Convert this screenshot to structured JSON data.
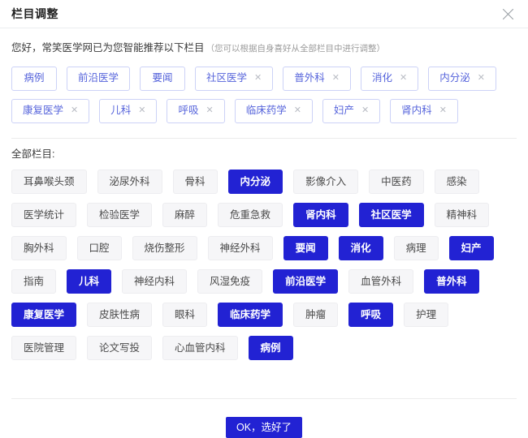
{
  "dialog": {
    "title": "栏目调整",
    "close_icon": "close-icon"
  },
  "intro": {
    "text": "您好，常笑医学网已为您智能推荐以下栏目",
    "hint": "（您可以根据自身喜好从全部栏目中进行调整）"
  },
  "selected_chips": [
    {
      "label": "病例",
      "removable": false
    },
    {
      "label": "前沿医学",
      "removable": false
    },
    {
      "label": "要闻",
      "removable": false
    },
    {
      "label": "社区医学",
      "removable": true
    },
    {
      "label": "普外科",
      "removable": true
    },
    {
      "label": "消化",
      "removable": true
    },
    {
      "label": "内分泌",
      "removable": true
    },
    {
      "label": "康复医学",
      "removable": true
    },
    {
      "label": "儿科",
      "removable": true
    },
    {
      "label": "呼吸",
      "removable": true
    },
    {
      "label": "临床药学",
      "removable": true
    },
    {
      "label": "妇产",
      "removable": true
    },
    {
      "label": "肾内科",
      "removable": true
    }
  ],
  "remove_icon_glyph": "✕",
  "all_section": {
    "label": "全部栏目:",
    "tags": [
      {
        "label": "耳鼻喉头颈",
        "selected": false
      },
      {
        "label": "泌尿外科",
        "selected": false
      },
      {
        "label": "骨科",
        "selected": false
      },
      {
        "label": "内分泌",
        "selected": true
      },
      {
        "label": "影像介入",
        "selected": false
      },
      {
        "label": "中医药",
        "selected": false
      },
      {
        "label": "感染",
        "selected": false
      },
      {
        "label": "医学统计",
        "selected": false
      },
      {
        "label": "检验医学",
        "selected": false
      },
      {
        "label": "麻醉",
        "selected": false
      },
      {
        "label": "危重急救",
        "selected": false
      },
      {
        "label": "肾内科",
        "selected": true
      },
      {
        "label": "社区医学",
        "selected": true
      },
      {
        "label": "精神科",
        "selected": false
      },
      {
        "label": "胸外科",
        "selected": false
      },
      {
        "label": "口腔",
        "selected": false
      },
      {
        "label": "烧伤整形",
        "selected": false
      },
      {
        "label": "神经外科",
        "selected": false
      },
      {
        "label": "要闻",
        "selected": true
      },
      {
        "label": "消化",
        "selected": true
      },
      {
        "label": "病理",
        "selected": false
      },
      {
        "label": "妇产",
        "selected": true
      },
      {
        "label": "指南",
        "selected": false
      },
      {
        "label": "儿科",
        "selected": true
      },
      {
        "label": "神经内科",
        "selected": false
      },
      {
        "label": "风湿免疫",
        "selected": false
      },
      {
        "label": "前沿医学",
        "selected": true
      },
      {
        "label": "血管外科",
        "selected": false
      },
      {
        "label": "普外科",
        "selected": true
      },
      {
        "label": "康复医学",
        "selected": true
      },
      {
        "label": "皮肤性病",
        "selected": false
      },
      {
        "label": "眼科",
        "selected": false
      },
      {
        "label": "临床药学",
        "selected": true
      },
      {
        "label": "肿瘤",
        "selected": false
      },
      {
        "label": "呼吸",
        "selected": true
      },
      {
        "label": "护理",
        "selected": false
      },
      {
        "label": "医院管理",
        "selected": false
      },
      {
        "label": "论文写投",
        "selected": false
      },
      {
        "label": "心血管内科",
        "selected": false
      },
      {
        "label": "病例",
        "selected": true
      }
    ]
  },
  "footer": {
    "confirm_label": "OK，选好了"
  },
  "colors": {
    "accent": "#2222d3",
    "chip_text": "#5563db",
    "chip_border": "#ccd2f7",
    "tag_bg": "#f6f6f8",
    "divider": "#ececec"
  }
}
